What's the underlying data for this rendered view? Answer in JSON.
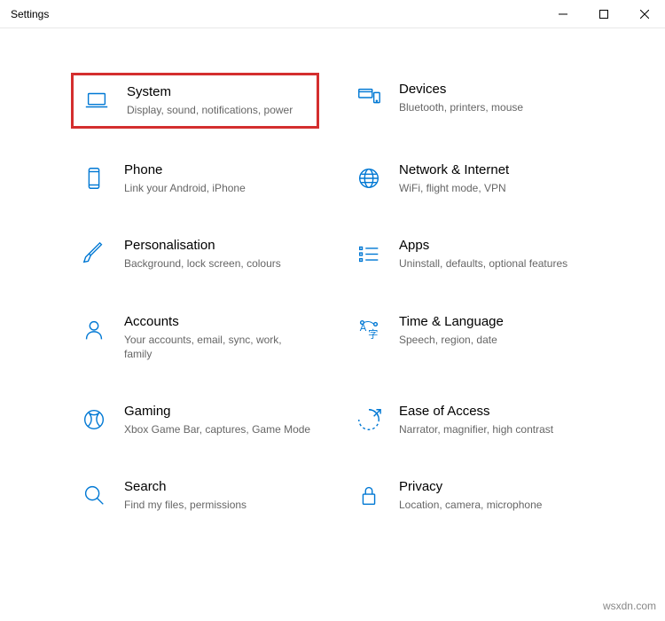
{
  "window": {
    "title": "Settings"
  },
  "categories": [
    {
      "key": "system",
      "title": "System",
      "desc": "Display, sound, notifications, power",
      "highlighted": true
    },
    {
      "key": "devices",
      "title": "Devices",
      "desc": "Bluetooth, printers, mouse"
    },
    {
      "key": "phone",
      "title": "Phone",
      "desc": "Link your Android, iPhone"
    },
    {
      "key": "network",
      "title": "Network & Internet",
      "desc": "WiFi, flight mode, VPN"
    },
    {
      "key": "personalisation",
      "title": "Personalisation",
      "desc": "Background, lock screen, colours"
    },
    {
      "key": "apps",
      "title": "Apps",
      "desc": "Uninstall, defaults, optional features"
    },
    {
      "key": "accounts",
      "title": "Accounts",
      "desc": "Your accounts, email, sync, work, family"
    },
    {
      "key": "time",
      "title": "Time & Language",
      "desc": "Speech, region, date"
    },
    {
      "key": "gaming",
      "title": "Gaming",
      "desc": "Xbox Game Bar, captures, Game Mode"
    },
    {
      "key": "ease",
      "title": "Ease of Access",
      "desc": "Narrator, magnifier, high contrast"
    },
    {
      "key": "search",
      "title": "Search",
      "desc": "Find my files, permissions"
    },
    {
      "key": "privacy",
      "title": "Privacy",
      "desc": "Location, camera, microphone"
    }
  ],
  "watermark": "wsxdn.com"
}
